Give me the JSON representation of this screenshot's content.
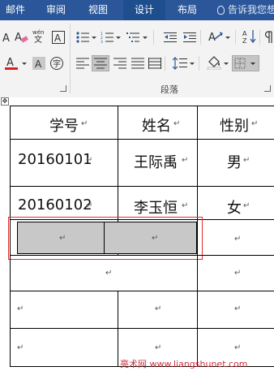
{
  "ribbon": {
    "tabs": [
      "邮件",
      "审阅",
      "视图",
      "设计",
      "布局"
    ],
    "tell_me": "告诉我您想",
    "group_label": "段落"
  },
  "table": {
    "header": [
      "学号",
      "姓名",
      "性别"
    ],
    "rows": [
      [
        "20160101",
        "王际禹",
        "男"
      ],
      [
        "20160102",
        "李玉恒",
        "女"
      ]
    ],
    "mark": "↵"
  },
  "watermark": "亮术网 www.liangshunet.com"
}
